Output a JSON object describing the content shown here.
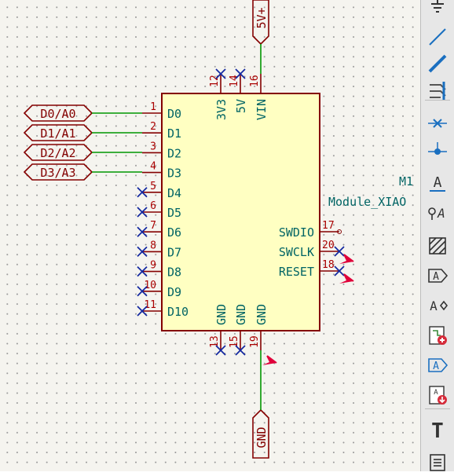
{
  "symbol": {
    "reference": "M1",
    "value": "Module_XIAO",
    "left_pins": [
      {
        "num": "1",
        "name": "D0"
      },
      {
        "num": "2",
        "name": "D1"
      },
      {
        "num": "3",
        "name": "D2"
      },
      {
        "num": "4",
        "name": "D3"
      },
      {
        "num": "5",
        "name": "D4"
      },
      {
        "num": "6",
        "name": "D5"
      },
      {
        "num": "7",
        "name": "D6"
      },
      {
        "num": "8",
        "name": "D7"
      },
      {
        "num": "9",
        "name": "D8"
      },
      {
        "num": "10",
        "name": "D9"
      },
      {
        "num": "11",
        "name": "D10"
      }
    ],
    "right_pins": [
      {
        "num": "17",
        "name": "SWDIO"
      },
      {
        "num": "20",
        "name": "SWCLK"
      },
      {
        "num": "18",
        "name": "RESET"
      }
    ],
    "top_pins": [
      {
        "num": "12",
        "name": "3V3"
      },
      {
        "num": "14",
        "name": "5V"
      },
      {
        "num": "16",
        "name": "VIN"
      }
    ],
    "bottom_pins": [
      {
        "num": "13",
        "name": "GND"
      },
      {
        "num": "15",
        "name": "GND"
      },
      {
        "num": "19",
        "name": "GND"
      }
    ]
  },
  "labels": {
    "global": [
      "D0/A0",
      "D1/A1",
      "D2/A2",
      "D3/A3"
    ],
    "power_top": "5V+",
    "power_bottom": "GND"
  },
  "toolbar": [
    {
      "name": "ground-icon"
    },
    {
      "name": "draw-wire-icon"
    },
    {
      "name": "draw-bus-icon"
    },
    {
      "name": "bus-entry-icon"
    },
    {
      "name": "no-connect-flag-icon"
    },
    {
      "name": "junction-icon"
    },
    {
      "name": "net-label-icon",
      "glyph": "A"
    },
    {
      "name": "net-class-directive-icon",
      "glyph": "A"
    },
    {
      "name": "rule-area-icon"
    },
    {
      "name": "global-label-icon",
      "glyph": "A"
    },
    {
      "name": "hierarchical-label-icon",
      "glyph": "A"
    },
    {
      "name": "hierarchical-sheet-icon"
    },
    {
      "name": "import-sheet-pin-icon",
      "glyph": "A"
    },
    {
      "name": "sync-sheet-pins-icon",
      "glyph": "A"
    },
    {
      "name": "text-icon",
      "glyph": "T"
    },
    {
      "name": "text-box-icon"
    }
  ],
  "colors": {
    "body_fill": "#ffffc2",
    "body_stroke": "#840000",
    "wire": "#009600",
    "no_connect": "#1428a0",
    "pin_text": "#006464",
    "pin_number": "#a90000",
    "marker": "#e0003a",
    "background": "#f5f4ef"
  }
}
